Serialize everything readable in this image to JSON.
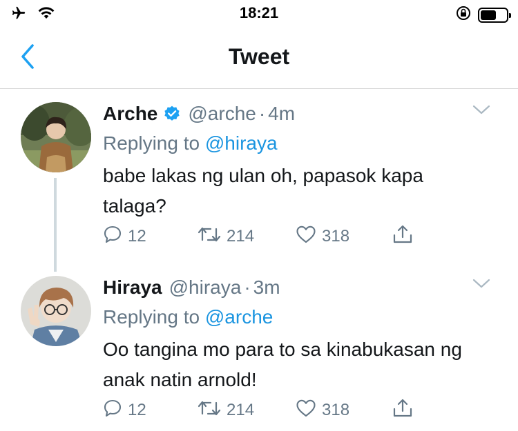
{
  "status_bar": {
    "time": "18:21",
    "battery_level": 0.6,
    "icons": [
      "airplane-icon",
      "wifi-icon",
      "orientation-lock-icon",
      "battery-icon"
    ]
  },
  "nav": {
    "title": "Tweet",
    "back_icon": "chevron-left-icon",
    "accent": "#1da1f2"
  },
  "tweets": [
    {
      "name": "Arche",
      "verified": true,
      "handle": "@arche",
      "dot": "·",
      "time": "4m",
      "replying_prefix": "Replying to",
      "replying_to": "@hiraya",
      "text": "babe lakas ng ulan oh, papasok kapa talaga?",
      "replies": "12",
      "retweets": "214",
      "likes": "318"
    },
    {
      "name": "Hiraya",
      "verified": false,
      "handle": "@hiraya",
      "dot": "·",
      "time": "3m",
      "replying_prefix": "Replying to",
      "replying_to": "@arche",
      "text": "Oo tangina mo para to sa kinabukasan ng anak natin arnold!",
      "replies": "12",
      "retweets": "214",
      "likes": "318"
    }
  ],
  "colors": {
    "link": "#1b95e0",
    "secondary_text": "#657786",
    "thread_line": "#cfd9de"
  }
}
